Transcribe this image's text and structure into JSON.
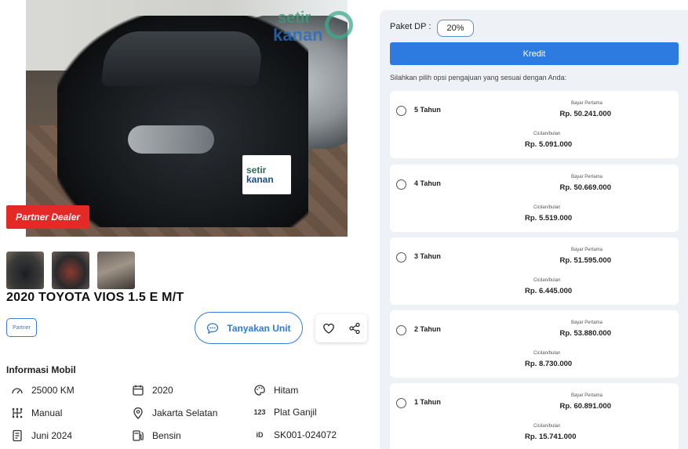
{
  "listing": {
    "watermark_top": "setir",
    "watermark_bottom": "kanan",
    "plate_top": "setir",
    "plate_bottom": "kanan",
    "partner_dealer_label": "Partner Dealer",
    "title": "2020 TOYOTA VIOS 1.5 E M/T",
    "partner_badge": "Partner",
    "ask_label": "Tanyakan Unit",
    "info_title": "Informasi Mobil",
    "specs": {
      "mileage": "25000 KM",
      "year": "2020",
      "color": "Hitam",
      "transmission": "Manual",
      "location": "Jakarta Selatan",
      "plate_type": "Plat Ganjil",
      "date": "Juni 2024",
      "fuel": "Bensin",
      "sku": "SK001-024072"
    },
    "icons": {
      "mileage": "gauge-icon",
      "year": "calendar-icon",
      "color": "palette-icon",
      "transmission": "gearbox-icon",
      "location": "location-pin-icon",
      "plate_type": "number-123-icon",
      "date": "document-icon",
      "fuel": "fuel-pump-icon",
      "sku": "id-icon"
    }
  },
  "kredit": {
    "dp_label": "Paket DP :",
    "dp_value": "20%",
    "button_label": "Kredit",
    "hint": "Silahkan pilih opsi pengajuan yang sesuai dengan Anda:",
    "first_payment_label": "Bayar Pertama",
    "monthly_label": "Cicilan/bulan",
    "options": [
      {
        "tenor": "5 Tahun",
        "first_payment": "Rp. 50.241.000",
        "monthly": "Rp. 5.091.000"
      },
      {
        "tenor": "4 Tahun",
        "first_payment": "Rp. 50.669.000",
        "monthly": "Rp. 5.519.000"
      },
      {
        "tenor": "3 Tahun",
        "first_payment": "Rp. 51.595.000",
        "monthly": "Rp. 6.445.000"
      },
      {
        "tenor": "2 Tahun",
        "first_payment": "Rp. 53.880.000",
        "monthly": "Rp. 8.730.000"
      },
      {
        "tenor": "1 Tahun",
        "first_payment": "Rp. 60.891.000",
        "monthly": "Rp. 15.741.000"
      }
    ]
  },
  "colors": {
    "accent": "#2d7be0",
    "partner_red": "#e32a26",
    "panel_bg": "#eef1f6"
  }
}
